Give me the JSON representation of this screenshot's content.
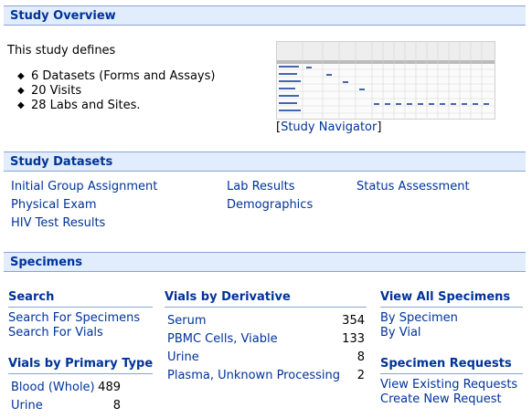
{
  "overview": {
    "header": "Study Overview",
    "intro": "This study defines",
    "bullets": [
      "6 Datasets (Forms and Assays)",
      "20 Visits",
      "28 Labs and Sites."
    ],
    "navigator_link": "Study Navigator"
  },
  "datasets": {
    "header": "Study Datasets",
    "col1": [
      "Initial Group Assignment",
      "Physical Exam",
      "HIV Test Results"
    ],
    "col2": [
      "Lab Results",
      "Demographics"
    ],
    "col3": [
      "Status Assessment"
    ]
  },
  "specimens": {
    "header": "Specimens",
    "search": {
      "title": "Search",
      "links": [
        "Search For Specimens",
        "Search For Vials"
      ]
    },
    "primary_type": {
      "title": "Vials by Primary Type",
      "rows": [
        {
          "label": "Blood (Whole)",
          "count": "489"
        },
        {
          "label": "Urine",
          "count": "8"
        }
      ]
    },
    "derivative": {
      "title": "Vials by Derivative",
      "rows": [
        {
          "label": "Serum",
          "count": "354"
        },
        {
          "label": "PBMC Cells, Viable",
          "count": "133"
        },
        {
          "label": "Urine",
          "count": "8"
        },
        {
          "label": "Plasma, Unknown Processing",
          "count": "2"
        }
      ]
    },
    "all": {
      "title": "View All Specimens",
      "links": [
        "By Specimen",
        "By Vial"
      ]
    },
    "requests": {
      "title": "Specimen Requests",
      "links": [
        "View Existing Requests",
        "Create New Request"
      ]
    }
  },
  "colors": {
    "header_bg": "#e1ecfc",
    "header_border": "#89a4cf",
    "link": "#003399"
  }
}
